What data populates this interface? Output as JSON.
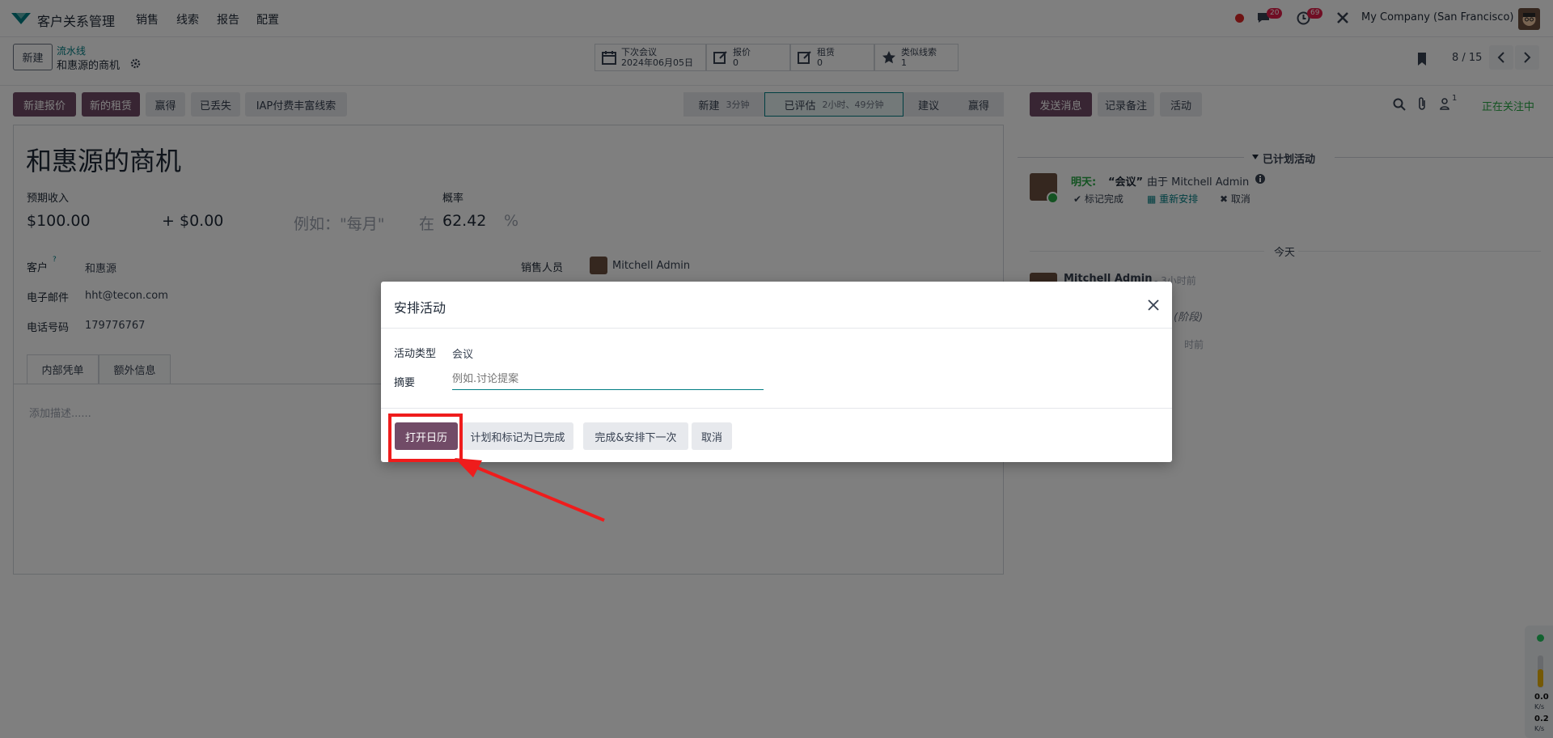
{
  "navbar": {
    "app": "客户关系管理",
    "menu": [
      "销售",
      "线索",
      "报告",
      "配置"
    ],
    "chat_badge": "20",
    "activity_badge": "69",
    "company": "My Company (San Francisco)"
  },
  "control": {
    "new": "新建",
    "breadcrumb_parent": "流水线",
    "breadcrumb_current": "和惠源的商机",
    "pager": "8 / 15",
    "smart": [
      {
        "label": "下次会议",
        "value": "2024年06月05日"
      },
      {
        "label": "报价",
        "value": "0"
      },
      {
        "label": "租赁",
        "value": "0"
      },
      {
        "label": "类似线索",
        "value": "1"
      }
    ]
  },
  "actions": {
    "new_quote": "新建报价",
    "new_rental": "新的租赁",
    "won": "赢得",
    "lost": "已丢失",
    "iap": "IAP付费丰富线索"
  },
  "stages": [
    {
      "name": "新建",
      "time": "3分钟"
    },
    {
      "name": "已评估",
      "time": "2小时、49分钟"
    },
    {
      "name": "建议",
      "time": ""
    },
    {
      "name": "赢得",
      "time": ""
    }
  ],
  "form": {
    "title": "和惠源的商机",
    "expected_revenue_label": "预期收入",
    "probability_label": "概率",
    "revenue": "$100.00",
    "plus": "+",
    "recurring": "$0.00",
    "recurring_placeholder": "例如：\"每月\"",
    "at": "在",
    "probability": "62.42",
    "percent": "%",
    "customer_label": "客户",
    "customer_help": "?",
    "customer": "和惠源",
    "email_label": "电子邮件",
    "email": "hht@tecon.com",
    "phone_label": "电话号码",
    "phone": "179776767",
    "salesperson_label": "销售人员",
    "salesperson": "Mitchell Admin",
    "tabs": [
      "内部凭单",
      "额外信息"
    ],
    "description_placeholder": "添加描述......"
  },
  "chatter": {
    "send": "发送消息",
    "log": "记录备注",
    "activity": "活动",
    "followers": "1",
    "following": "正在关注中",
    "planned": "已计划活动",
    "activity_when": "明天:",
    "activity_title": "“会议”",
    "activity_by": "由于 Mitchell Admin",
    "mark_done": "标记完成",
    "reschedule": "重新安排",
    "cancel": "取消",
    "today": "今天",
    "msg_author": "Mitchell Admin",
    "msg_time": "- 3小时前",
    "msg_stage": "(阶段)",
    "msg_time2": "时前"
  },
  "dialog": {
    "title": "安排活动",
    "type_label": "活动类型",
    "type_value": "会议",
    "summary_label": "摘要",
    "summary_placeholder": "例如.讨论提案",
    "btn_calendar": "打开日历",
    "btn_done": "计划和标记为已完成",
    "btn_next": "完成&安排下一次",
    "btn_cancel": "取消"
  },
  "net": {
    "up": "0.0",
    "up_unit": "K/s",
    "down": "0.2",
    "down_unit": "K/s"
  },
  "colors": {
    "primary": "#714b67",
    "highlight": "#ef1c1c",
    "green": "#28a745",
    "link": "#017e84"
  }
}
